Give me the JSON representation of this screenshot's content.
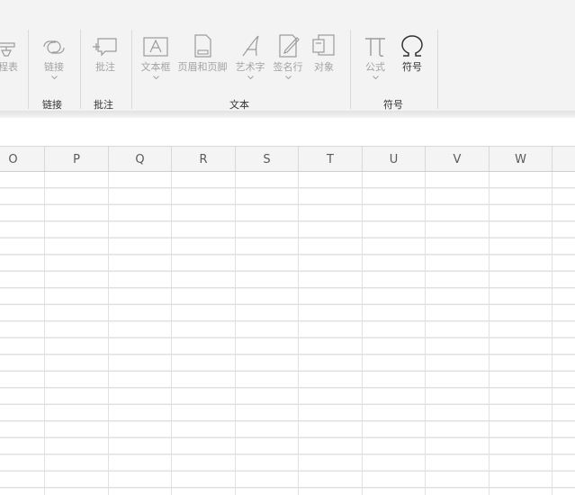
{
  "ribbon": {
    "partial_left_label": "程表",
    "link": {
      "label": "链接",
      "group_label": "链接"
    },
    "comment": {
      "label": "批注",
      "group_label": "批注"
    },
    "text_group": {
      "group_label": "文本",
      "items": [
        "文本框",
        "页眉和页脚",
        "艺术字",
        "签名行",
        "对象"
      ]
    },
    "symbols_group": {
      "group_label": "符号",
      "formula_label": "公式",
      "symbol_label": "符号"
    }
  },
  "columns": [
    "O",
    "P",
    "Q",
    "R",
    "S",
    "T",
    "U",
    "V",
    "W"
  ],
  "colors": {
    "ribbon_bg": "#f3f3f3",
    "header_bg": "#f4f4f4",
    "grid_line": "#e1e1e1",
    "disabled_text": "#a3a3a3"
  }
}
